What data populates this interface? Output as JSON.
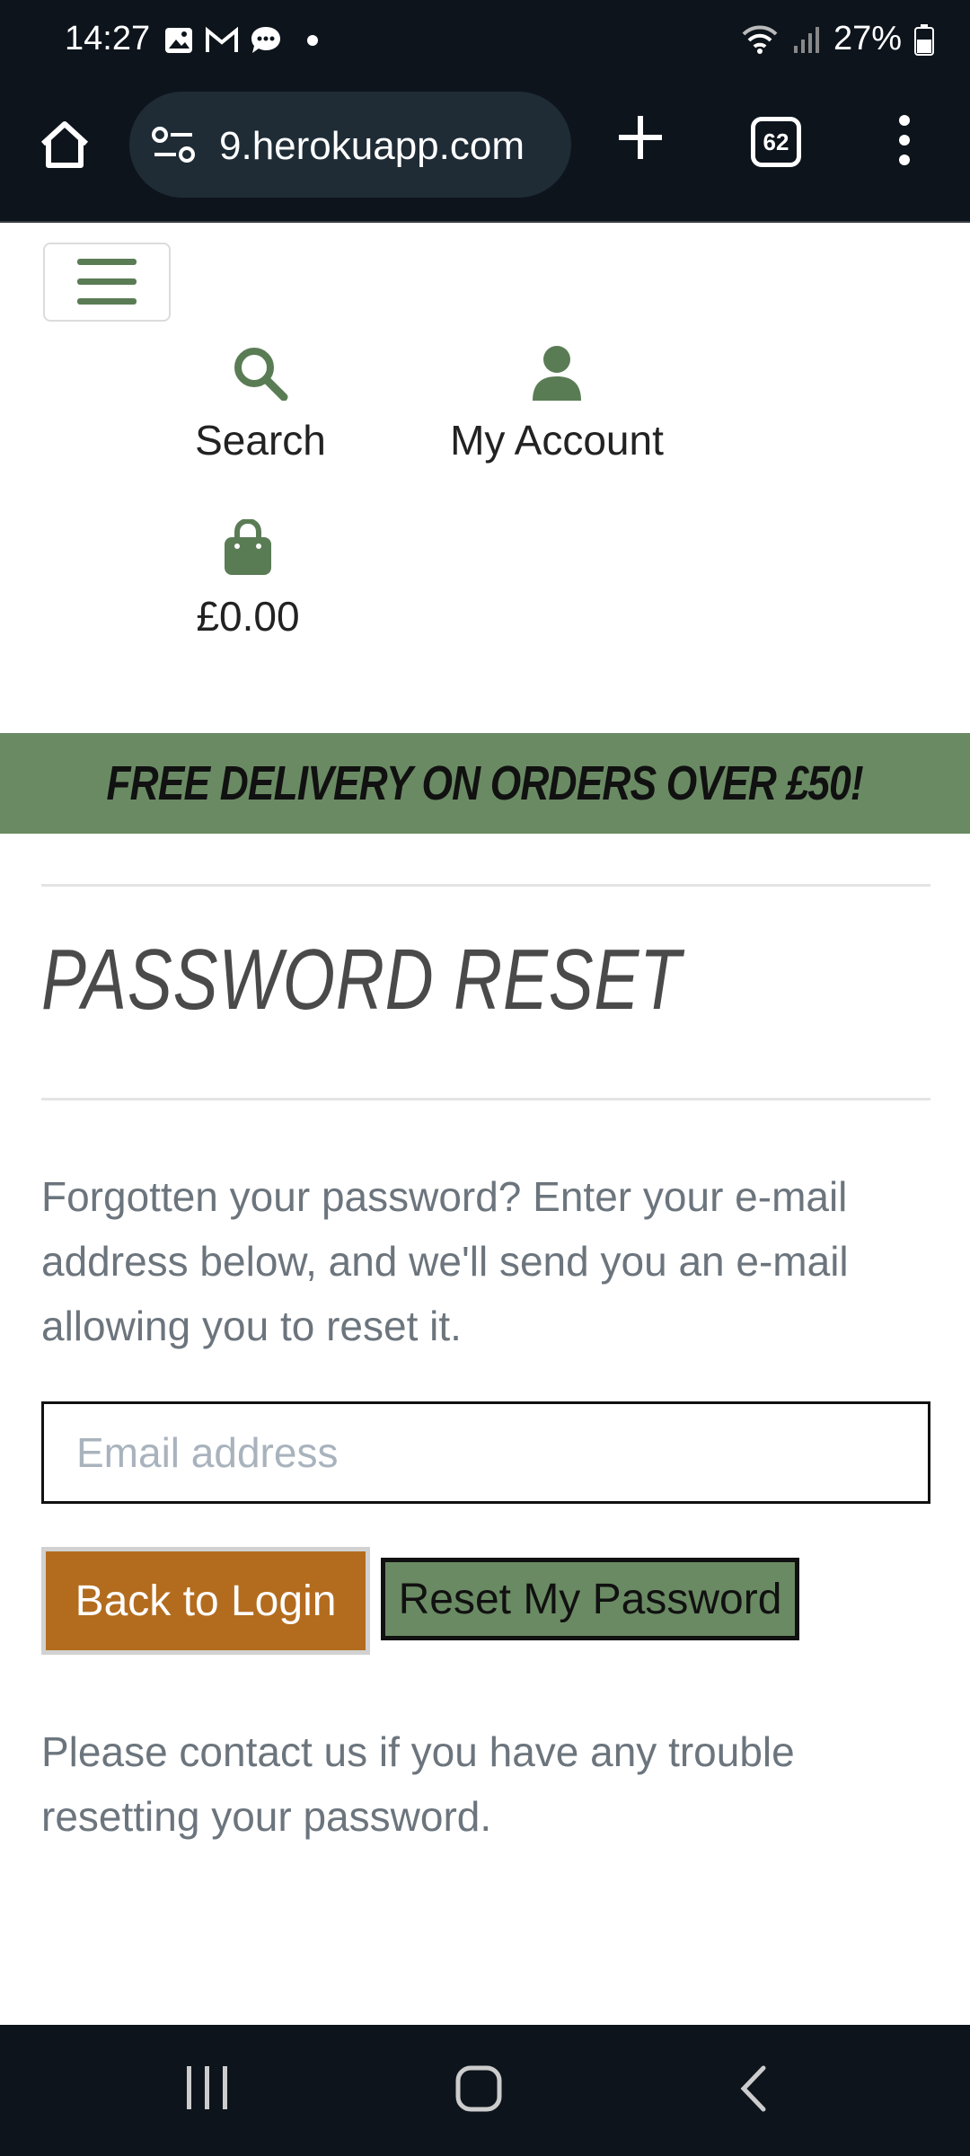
{
  "status_bar": {
    "time": "14:27",
    "battery": "27%"
  },
  "browser": {
    "url": "9.herokuapp.com",
    "tab_count": "62"
  },
  "header": {
    "search_label": "Search",
    "account_label": "My Account",
    "bag_total": "£0.00"
  },
  "banner": {
    "text": "FREE DELIVERY ON ORDERS OVER £50!"
  },
  "main": {
    "title": "PASSWORD RESET",
    "intro": "Forgotten your password? Enter your e-mail address below, and we'll send you an e-mail allowing you to reset it.",
    "email_placeholder": "Email address",
    "back_button": "Back to Login",
    "reset_button": "Reset My Password",
    "footer_note": "Please contact us if you have any trouble resetting your password."
  },
  "colors": {
    "accent_green": "#6a8a63",
    "button_orange": "#b36c1e"
  },
  "icons": [
    "home-icon",
    "site-info-icon",
    "plus-icon",
    "tabs-icon",
    "more-icon",
    "hamburger-icon",
    "search-icon",
    "user-icon",
    "bag-icon"
  ]
}
